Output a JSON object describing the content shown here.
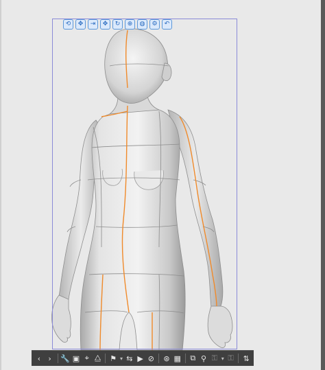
{
  "object_launcher": {
    "buttons": [
      {
        "name": "camera-rotate-icon",
        "glyph": "⟲"
      },
      {
        "name": "camera-move-icon",
        "glyph": "✥"
      },
      {
        "name": "camera-dolly-icon",
        "glyph": "⇥"
      },
      {
        "name": "object-move-icon",
        "glyph": "✥"
      },
      {
        "name": "object-rotate-icon",
        "glyph": "↻"
      },
      {
        "name": "object-rotate-xy-icon",
        "glyph": "⊕"
      },
      {
        "name": "object-scale-icon",
        "glyph": "◍"
      },
      {
        "name": "gear-icon",
        "glyph": "⚙"
      },
      {
        "name": "undo-icon",
        "glyph": "↶"
      }
    ]
  },
  "bottom_toolbar": {
    "buttons": [
      {
        "name": "previous-object-icon",
        "glyph": "‹",
        "dim": false
      },
      {
        "name": "next-object-icon",
        "glyph": "›",
        "dim": false
      },
      {
        "name": "wrench-settings-icon",
        "glyph": "🔧",
        "dim": false
      },
      {
        "name": "camera-angle-icon",
        "glyph": "▣",
        "dim": false
      },
      {
        "name": "focus-object-icon",
        "glyph": "⌖",
        "dim": false
      },
      {
        "name": "ground-icon",
        "glyph": "⧋",
        "dim": false
      },
      {
        "name": "pose-icon",
        "glyph": "⚑",
        "dim": false
      },
      {
        "name": "pose-flip-icon",
        "glyph": "⇆",
        "dim": false
      },
      {
        "name": "play-motion-icon",
        "glyph": "▶",
        "dim": false
      },
      {
        "name": "lock-joint-icon",
        "glyph": "⊘",
        "dim": false
      },
      {
        "name": "restore-pose-icon",
        "glyph": "⊛",
        "dim": false
      },
      {
        "name": "grid-icon",
        "glyph": "▦",
        "dim": false
      },
      {
        "name": "body-shape-icon",
        "glyph": "⧉",
        "dim": false
      },
      {
        "name": "fix-joint-icon",
        "glyph": "⚲",
        "dim": false
      },
      {
        "name": "lock-icon",
        "glyph": "⚿",
        "dim": true
      },
      {
        "name": "unlock-icon",
        "glyph": "⚿",
        "dim": true
      },
      {
        "name": "layer-settings-icon",
        "glyph": "⇅",
        "dim": false
      }
    ]
  },
  "colors": {
    "background": "#e9e9e9",
    "figure_fill": "#d7d7d7",
    "figure_shadow": "#9f9f9f",
    "guide_orange": "#f08a2a",
    "grid_line": "#8c8c8c",
    "selection_frame": "#8a8ad8",
    "toolbar": "#3f3f3f"
  }
}
